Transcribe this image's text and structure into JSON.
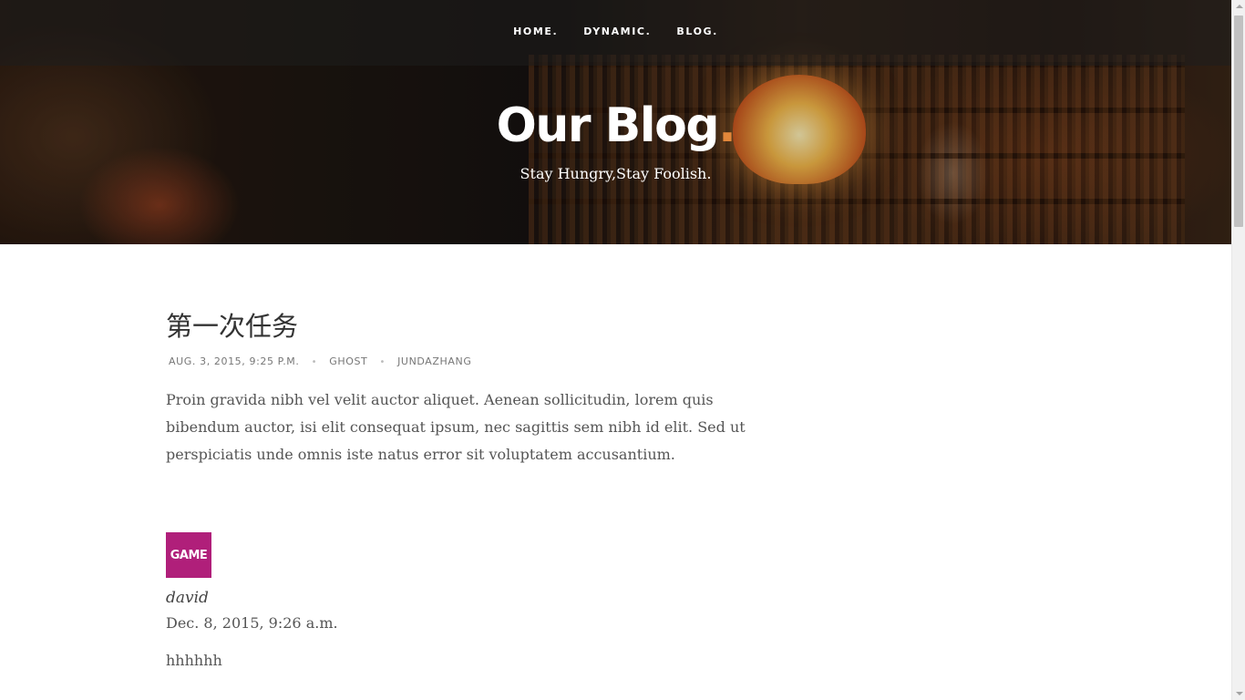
{
  "nav": {
    "items": [
      {
        "label": "HOME."
      },
      {
        "label": "DYNAMIC."
      },
      {
        "label": "BLOG."
      }
    ]
  },
  "hero": {
    "title": "Our Blog",
    "title_dot": ".",
    "tagline": "Stay Hungry,Stay Foolish."
  },
  "post": {
    "title": "第一次任务",
    "date": "AUG. 3, 2015, 9:25 P.M.",
    "category": "GHOST",
    "author": "JUNDAZHANG",
    "separator": "•",
    "body": "Proin gravida nibh vel velit auctor aliquet. Aenean sollicitudin, lorem quis bibendum auctor, isi elit consequat ipsum, nec sagittis sem nibh id elit. Sed ut perspiciatis unde omnis iste natus error sit voluptatem accusantium."
  },
  "comment": {
    "avatar_text": "GAME",
    "avatar_color": "#b01f7a",
    "author": "david",
    "date": "Dec. 8, 2015, 9:26 a.m.",
    "text": "hhhhhh"
  },
  "colors": {
    "accent": "#e4873a",
    "text": "#444444",
    "meta": "#777777"
  }
}
